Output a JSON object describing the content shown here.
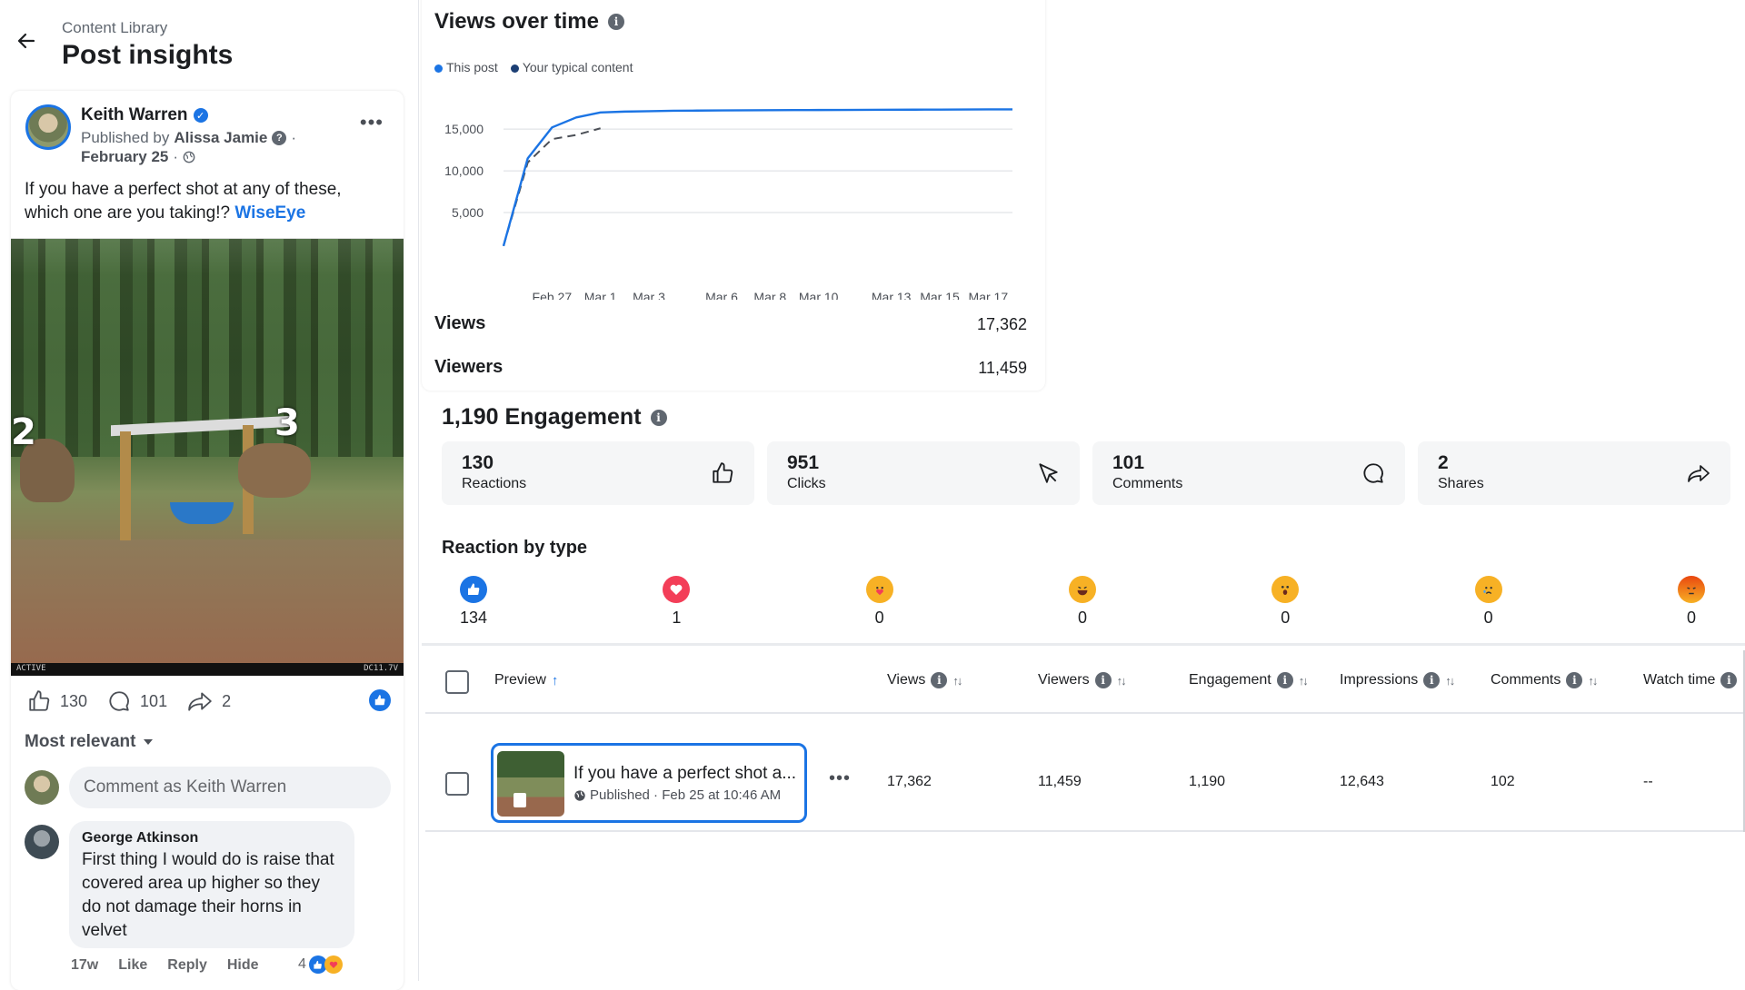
{
  "header": {
    "breadcrumb": "Content Library",
    "title": "Post insights"
  },
  "post": {
    "author": "Keith Warren",
    "published_by_prefix": "Published by",
    "published_by": "Alissa Jamie",
    "date": "February 25",
    "text": "If you have a perfect shot at any of these, which one are you taking!?",
    "tag": "WiseEye",
    "image_labels": [
      "2",
      "3"
    ],
    "camera_strip_left": "ACTIVE",
    "camera_strip_right": "DC11.7V",
    "stats": {
      "likes": "130",
      "comments": "101",
      "shares": "2"
    },
    "sort_label": "Most relevant",
    "comment_placeholder": "Comment as Keith Warren",
    "comment": {
      "author": "George Atkinson",
      "text": "First thing I would do is raise that covered area up higher so they do not damage their horns in velvet",
      "age": "17w",
      "like": "Like",
      "reply": "Reply",
      "hide": "Hide",
      "reactions": "4"
    }
  },
  "views_card": {
    "title": "Views over time",
    "legend": [
      "This post",
      "Your typical content"
    ],
    "views_label": "Views",
    "views_value": "17,362",
    "viewers_label": "Viewers",
    "viewers_value": "11,459"
  },
  "chart_data": {
    "type": "line",
    "x": [
      "Feb 25",
      "Feb 26",
      "Feb 27",
      "Feb 28",
      "Mar 1",
      "Mar 2",
      "Mar 3",
      "Mar 4",
      "Mar 5",
      "Mar 6",
      "Mar 7",
      "Mar 8",
      "Mar 9",
      "Mar 10",
      "Mar 11",
      "Mar 12",
      "Mar 13",
      "Mar 14",
      "Mar 15",
      "Mar 16",
      "Mar 17",
      "Mar 18"
    ],
    "tick_labels": [
      "Feb 27",
      "Mar 1",
      "Mar 3",
      "Mar 6",
      "Mar 8",
      "Mar 10",
      "Mar 13",
      "Mar 15",
      "Mar 17"
    ],
    "yticks": [
      "15,000",
      "10,000",
      "5,000"
    ],
    "ylim": [
      0,
      18500
    ],
    "series": [
      {
        "name": "This post",
        "color": "#1b74e4",
        "dashed": false,
        "values": [
          1000,
          11500,
          15200,
          16400,
          17000,
          17100,
          17150,
          17200,
          17220,
          17240,
          17260,
          17270,
          17280,
          17290,
          17300,
          17310,
          17320,
          17330,
          17340,
          17350,
          17360,
          17362
        ]
      },
      {
        "name": "Your typical content",
        "color": "#4b4f56",
        "dashed": true,
        "values": [
          1000,
          11000,
          13800,
          14300,
          15100,
          null,
          null,
          null,
          null,
          null,
          null,
          null,
          null,
          null,
          null,
          null,
          null,
          null,
          null,
          null,
          null,
          null
        ]
      }
    ],
    "grid": true,
    "legend": "top-left"
  },
  "engagement": {
    "title": "1,190 Engagement",
    "cards": [
      {
        "value": "130",
        "label": "Reactions",
        "icon": "thumbs-up-icon"
      },
      {
        "value": "951",
        "label": "Clicks",
        "icon": "cursor-icon"
      },
      {
        "value": "101",
        "label": "Comments",
        "icon": "comment-icon"
      },
      {
        "value": "2",
        "label": "Shares",
        "icon": "share-icon"
      }
    ],
    "reaction_title": "Reaction by type",
    "reactions": [
      {
        "name": "like",
        "count": "134",
        "color": "#1b74e4"
      },
      {
        "name": "love",
        "count": "1",
        "color": "#f33e58"
      },
      {
        "name": "care",
        "count": "0",
        "color": "#f7b125"
      },
      {
        "name": "haha",
        "count": "0",
        "color": "#f7b125"
      },
      {
        "name": "wow",
        "count": "0",
        "color": "#f7b125"
      },
      {
        "name": "sad",
        "count": "0",
        "color": "#f7b125"
      },
      {
        "name": "angry",
        "count": "0",
        "color": "#e9710f"
      }
    ]
  },
  "table": {
    "headers": {
      "preview": "Preview",
      "views": "Views",
      "viewers": "Viewers",
      "engagement": "Engagement",
      "impressions": "Impressions",
      "comments": "Comments",
      "watch_time": "Watch time"
    },
    "row": {
      "title": "If you have a perfect shot a...",
      "meta": "Published · Feb 25 at 10:46 AM",
      "views": "17,362",
      "viewers": "11,459",
      "engagement": "1,190",
      "impressions": "12,643",
      "comments": "102",
      "watch_time": "--"
    }
  },
  "colors": {
    "accent": "#1b74e4",
    "text": "#1c1e21",
    "muted": "#606770"
  }
}
